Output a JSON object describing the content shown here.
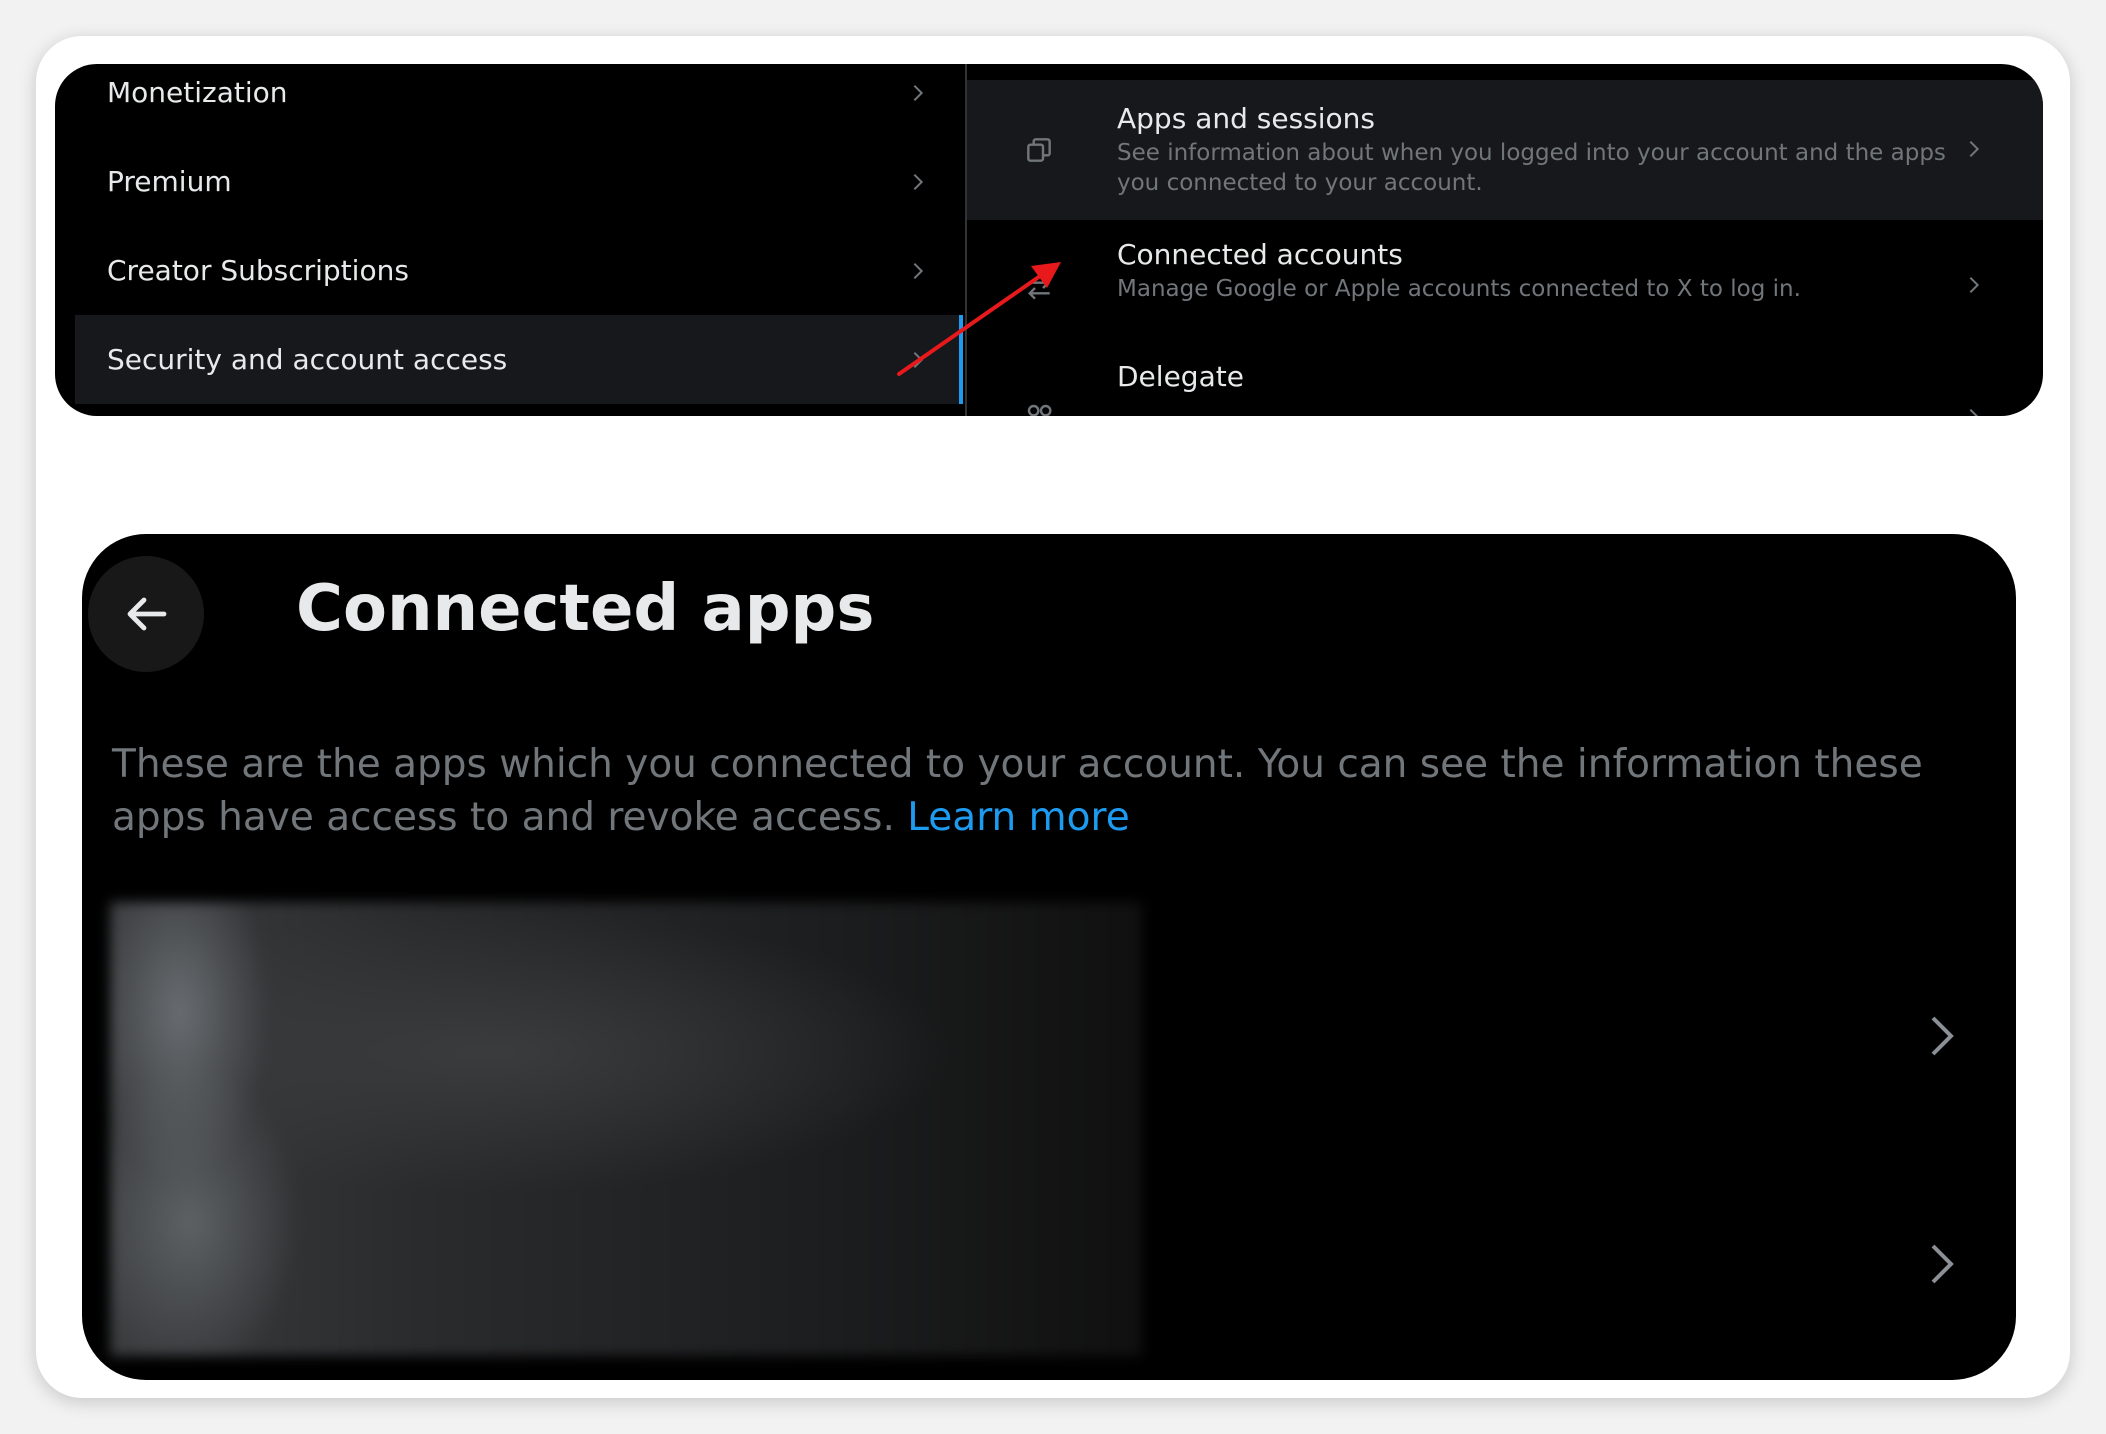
{
  "settings_menu": {
    "items": [
      {
        "label": "Monetization",
        "active": false
      },
      {
        "label": "Premium",
        "active": false
      },
      {
        "label": "Creator Subscriptions",
        "active": false
      },
      {
        "label": "Security and account access",
        "active": true
      }
    ]
  },
  "security_options": {
    "apps_sessions": {
      "title": "Apps and sessions",
      "description": "See information about when you logged into your account and the apps you connected to your account."
    },
    "connected_accounts": {
      "title": "Connected accounts",
      "description": "Manage Google or Apple accounts connected to X to log in."
    },
    "delegate": {
      "title": "Delegate"
    }
  },
  "connected_apps": {
    "title": "Connected apps",
    "intro": "These are the apps which you connected to your account. You can see the information these apps have access to and revoke access.",
    "learn_more": "Learn more"
  },
  "colors": {
    "background": "#000000",
    "primary_text": "#e7e9ea",
    "secondary_text": "#71767b",
    "accent": "#1d9bf0",
    "highlight_row": "#16181c",
    "annotation_arrow": "#e8191b"
  },
  "icons": [
    "chevron-right-icon",
    "copy-icon",
    "swap-arrows-icon",
    "people-icon",
    "back-arrow-icon"
  ]
}
